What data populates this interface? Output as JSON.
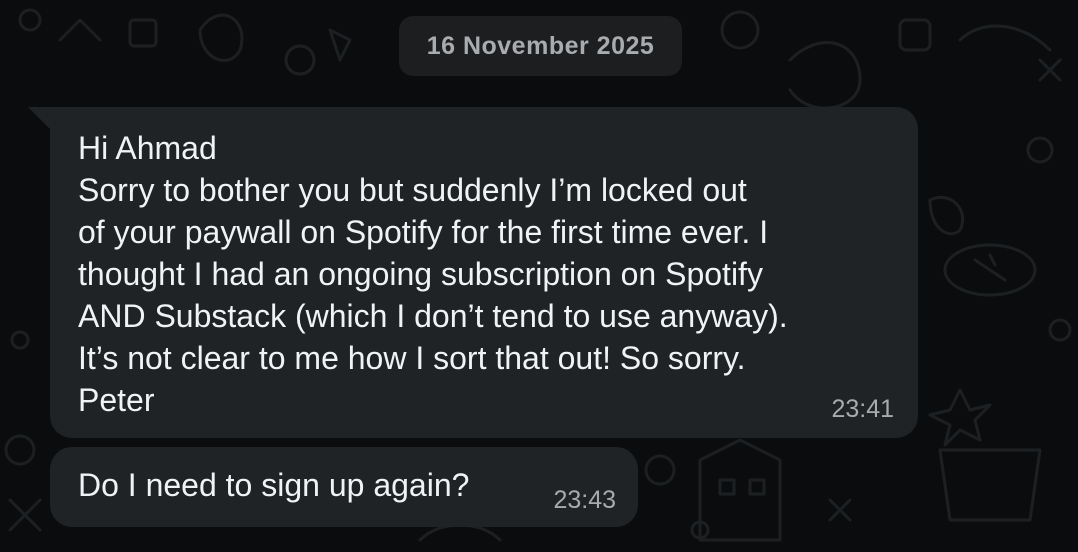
{
  "chat": {
    "date_separator": "16 November 2025",
    "messages": [
      {
        "text": "Hi Ahmad\nSorry to bother you but suddenly I’m locked out\nof your paywall on Spotify for the first time ever.  I\nthought I had an ongoing subscription on Spotify\nAND Substack (which I don’t tend to use anyway).\nIt’s not clear to me how I sort that out!  So sorry.\nPeter",
        "time": "23:41"
      },
      {
        "text": "Do I need to sign up again?",
        "time": "23:43"
      }
    ]
  },
  "colors": {
    "background": "#0b0c0d",
    "bubble_incoming": "#1f2326",
    "date_chip": "#1c1e20",
    "message_text": "#f1f2f3",
    "timestamp_text": "#a7abae"
  }
}
